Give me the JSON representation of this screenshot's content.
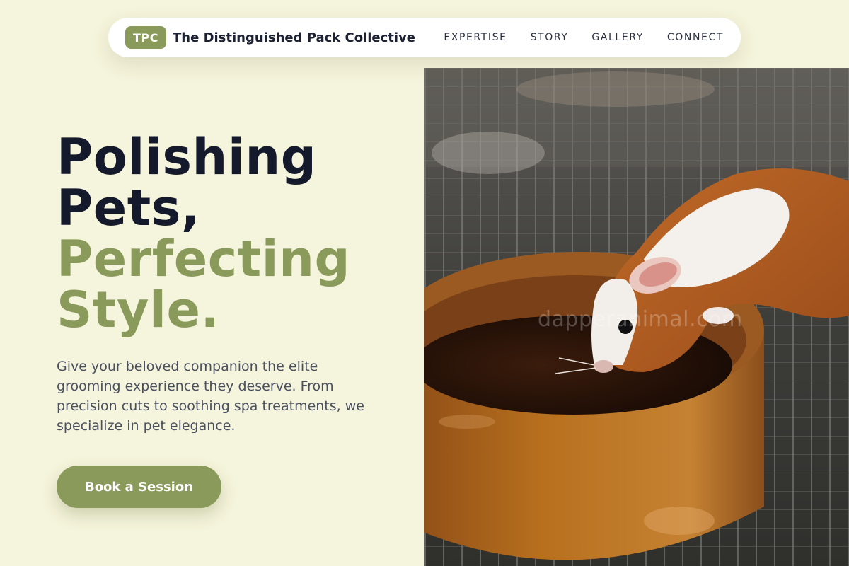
{
  "brand": {
    "badge": "TPC",
    "name": "The Distinguished Pack Collective"
  },
  "nav": {
    "links": [
      "EXPERTISE",
      "STORY",
      "GALLERY",
      "CONNECT"
    ]
  },
  "hero": {
    "headline_line1": "Polishing",
    "headline_line2": "Pets,",
    "headline_line3": "Perfecting",
    "headline_line4": "Style.",
    "subtext": "Give your beloved companion the elite grooming experience they deserve. From precision cuts to soothing spa treatments, we specialize in pet elegance.",
    "cta_label": "Book a Session",
    "image_watermark": "dapperanimal.com"
  },
  "colors": {
    "background": "#f5f4dc",
    "accent": "#8a9a5b",
    "heading": "#141a2b"
  }
}
